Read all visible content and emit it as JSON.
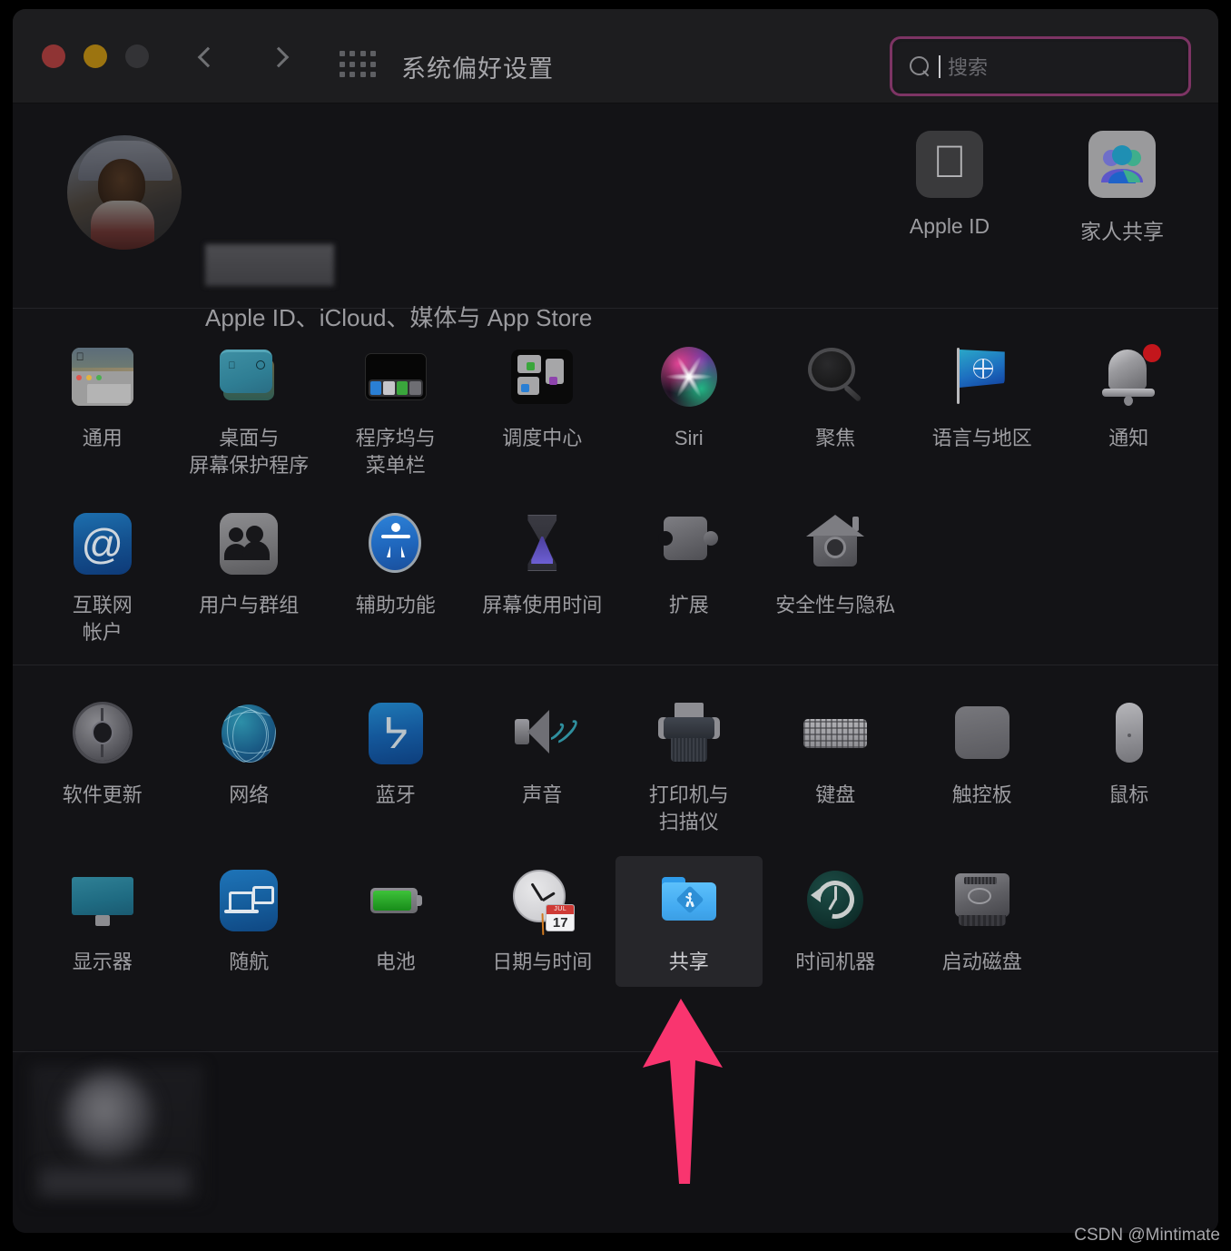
{
  "window": {
    "title": "系统偏好设置",
    "traffic_lights": [
      "close",
      "minimize",
      "zoom"
    ],
    "nav_back": "back-chevron",
    "nav_forward": "forward-chevron",
    "grid_button": "show-all-grid"
  },
  "search": {
    "placeholder": "搜索",
    "value": "",
    "focus_ring_color": "#7d3464",
    "icon": "search-icon"
  },
  "account": {
    "name": "",
    "name_redacted": true,
    "subtitle": "Apple ID、iCloud、媒体与 App Store",
    "avatar": "user-avatar",
    "buttons": [
      {
        "label": "Apple ID",
        "icon": "apple-logo-icon"
      },
      {
        "label": "家人共享",
        "icon": "family-sharing-icon"
      }
    ]
  },
  "sections": [
    {
      "id": "personal",
      "items": [
        {
          "label": "通用",
          "icon": "general-icon",
          "selected": false
        },
        {
          "label": "桌面与\n屏幕保护程序",
          "icon": "desktop-screensaver-icon",
          "selected": false
        },
        {
          "label": "程序坞与\n菜单栏",
          "icon": "dock-menubar-icon",
          "selected": false
        },
        {
          "label": "调度中心",
          "icon": "mission-control-icon",
          "selected": false
        },
        {
          "label": "Siri",
          "icon": "siri-icon",
          "selected": false
        },
        {
          "label": "聚焦",
          "icon": "spotlight-icon",
          "selected": false
        },
        {
          "label": "语言与地区",
          "icon": "language-region-icon",
          "selected": false
        },
        {
          "label": "通知",
          "icon": "notifications-icon",
          "selected": false,
          "badge": true
        },
        {
          "label": "互联网\n帐户",
          "icon": "internet-accounts-icon",
          "selected": false
        },
        {
          "label": "用户与群组",
          "icon": "users-groups-icon",
          "selected": false
        },
        {
          "label": "辅助功能",
          "icon": "accessibility-icon",
          "selected": false
        },
        {
          "label": "屏幕使用时间",
          "icon": "screen-time-icon",
          "selected": false
        },
        {
          "label": "扩展",
          "icon": "extensions-icon",
          "selected": false
        },
        {
          "label": "安全性与隐私",
          "icon": "security-privacy-icon",
          "selected": false
        }
      ]
    },
    {
      "id": "hardware",
      "items": [
        {
          "label": "软件更新",
          "icon": "software-update-icon",
          "selected": false
        },
        {
          "label": "网络",
          "icon": "network-icon",
          "selected": false
        },
        {
          "label": "蓝牙",
          "icon": "bluetooth-icon",
          "selected": false
        },
        {
          "label": "声音",
          "icon": "sound-icon",
          "selected": false
        },
        {
          "label": "打印机与\n扫描仪",
          "icon": "printers-scanners-icon",
          "selected": false
        },
        {
          "label": "键盘",
          "icon": "keyboard-icon",
          "selected": false
        },
        {
          "label": "触控板",
          "icon": "trackpad-icon",
          "selected": false
        },
        {
          "label": "鼠标",
          "icon": "mouse-icon",
          "selected": false
        },
        {
          "label": "显示器",
          "icon": "displays-icon",
          "selected": false
        },
        {
          "label": "随航",
          "icon": "sidecar-icon",
          "selected": false
        },
        {
          "label": "电池",
          "icon": "battery-icon",
          "selected": false
        },
        {
          "label": "日期与时间",
          "icon": "date-time-icon",
          "selected": false,
          "calendar_month": "JUL",
          "calendar_day": "17"
        },
        {
          "label": "共享",
          "icon": "sharing-icon",
          "selected": true
        },
        {
          "label": "时间机器",
          "icon": "time-machine-icon",
          "selected": false
        },
        {
          "label": "启动磁盘",
          "icon": "startup-disk-icon",
          "selected": false
        }
      ]
    }
  ],
  "annotation": {
    "arrow": "pink-up-arrow",
    "arrow_color": "#f9356f",
    "points_at": "共享"
  },
  "watermark": "CSDN @Mintimate"
}
